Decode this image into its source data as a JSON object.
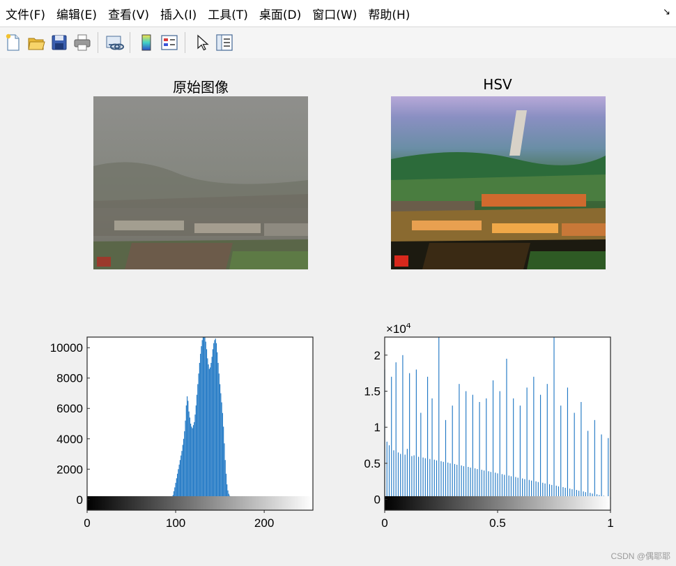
{
  "menu": {
    "items": [
      "文件(F)",
      "编辑(E)",
      "查看(V)",
      "插入(I)",
      "工具(T)",
      "桌面(D)",
      "窗口(W)",
      "帮助(H)"
    ],
    "overflow_arrow": "↘"
  },
  "toolbar": {
    "buttons": [
      "new-figure-icon",
      "open-file-icon",
      "save-icon",
      "print-icon",
      "link-plot-icon",
      "colorbar-icon",
      "legend-icon",
      "edit-plot-pointer-icon",
      "property-inspector-icon"
    ]
  },
  "panels": {
    "original_title": "原始图像",
    "hsv_title": "HSV"
  },
  "watermark": "CSDN @偶耶耶",
  "chart_data": [
    {
      "type": "bar",
      "title": "",
      "xlabel": "",
      "ylabel": "",
      "xlim": [
        0,
        255
      ],
      "ylim": [
        -700,
        10700
      ],
      "x_ticks": [
        "0",
        "100",
        "200"
      ],
      "y_ticks": [
        "0",
        "2000",
        "4000",
        "6000",
        "8000",
        "10000"
      ],
      "grid": false,
      "colorbar": "grayscale",
      "series": [
        {
          "x_start": 95,
          "x_step": 1,
          "values": [
            40,
            120,
            300,
            550,
            800,
            1100,
            1400,
            1700,
            2000,
            2300,
            2600,
            2900,
            3200,
            3600,
            4000,
            4500,
            5200,
            6200,
            6800,
            6500,
            5800,
            5400,
            5000,
            4800,
            4700,
            4900,
            5100,
            5600,
            6200,
            6900,
            7600,
            8300,
            9000,
            9600,
            10100,
            10500,
            10800,
            10800,
            10700,
            10400,
            9900,
            9300,
            8900,
            8600,
            8700,
            9000,
            9400,
            9900,
            10300,
            10500,
            10600,
            10300,
            9700,
            9000,
            8300,
            7600,
            7000,
            6400,
            5700,
            4800,
            3700,
            2600,
            1700,
            1000,
            600,
            380,
            250,
            170,
            120,
            80,
            60,
            40,
            20,
            10
          ]
        }
      ]
    },
    {
      "type": "bar",
      "title": "",
      "xlabel": "",
      "ylabel": "",
      "exponent_label": "×10",
      "exponent_power": "4",
      "xlim": [
        0,
        1
      ],
      "ylim": [
        -1500,
        22500
      ],
      "x_ticks": [
        "0",
        "0.5",
        "1"
      ],
      "y_ticks": [
        "0",
        "0.5",
        "1",
        "1.5",
        "2"
      ],
      "grid": false,
      "colorbar": "grayscale",
      "series": [
        {
          "x_start": 0,
          "x_step": 0.01,
          "values": [
            18000,
            8000,
            7500,
            17000,
            6800,
            19000,
            6500,
            6300,
            20000,
            6200,
            7000,
            17500,
            6000,
            6100,
            18000,
            5900,
            12000,
            5800,
            5700,
            17000,
            5600,
            14000,
            5500,
            5400,
            22500,
            5300,
            5200,
            11000,
            5100,
            5000,
            13000,
            4900,
            4800,
            16000,
            4700,
            4600,
            15000,
            4500,
            4400,
            14500,
            4300,
            4200,
            13500,
            4100,
            4000,
            14000,
            3900,
            3800,
            16500,
            3700,
            3600,
            15000,
            3500,
            3400,
            19500,
            3300,
            3200,
            14000,
            3100,
            3000,
            13000,
            2900,
            2800,
            15500,
            2700,
            2600,
            17000,
            2500,
            2400,
            14500,
            2300,
            2200,
            16000,
            2100,
            2000,
            22500,
            1900,
            1800,
            13000,
            1700,
            1600,
            15500,
            1500,
            1400,
            12000,
            1300,
            1200,
            13500,
            1100,
            1000,
            9500,
            900,
            800,
            11000,
            700,
            600,
            9000,
            500,
            400,
            8500,
            300
          ]
        }
      ]
    }
  ]
}
